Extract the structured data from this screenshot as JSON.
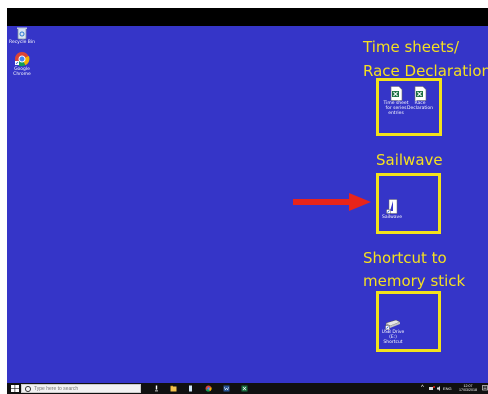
{
  "desktop": {
    "background_color": "#3535c8",
    "icons": [
      {
        "name": "recycle-bin",
        "label": "Recycle Bin"
      },
      {
        "name": "google-chrome",
        "label": "Google Chrome"
      },
      {
        "name": "time-sheet",
        "label": "Time sheet for series entries"
      },
      {
        "name": "race-declaration",
        "label": "Race Declaration"
      },
      {
        "name": "sailwave",
        "label": "Sailwave"
      },
      {
        "name": "memory-stick",
        "label": "USB Drive (E:) Shortcut"
      }
    ]
  },
  "annotations": {
    "time_sheets_line1": "Time sheets/",
    "time_sheets_line2": "Race Declaration",
    "sailwave": "Sailwave",
    "shortcut_line1": "Shortcut to",
    "shortcut_line2": "memory stick",
    "highlight_color": "#f3e21b",
    "arrow_color": "#e8241a"
  },
  "taskbar": {
    "search_placeholder": "Type here to search",
    "pinned_icons": [
      "mic-icon",
      "file-explorer-icon",
      "notepad-icon",
      "chrome-icon",
      "word-icon",
      "excel-icon"
    ],
    "tray": {
      "lang": "ENG",
      "time": "12:07",
      "date": "17/03/2018"
    }
  }
}
